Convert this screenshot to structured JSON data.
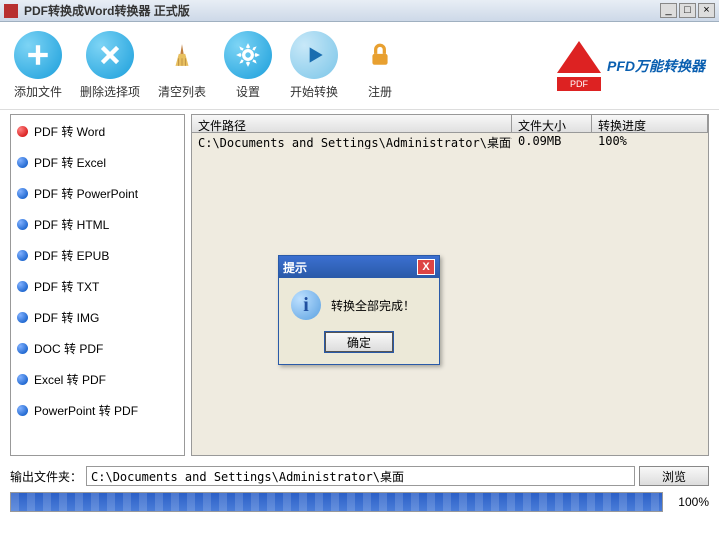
{
  "title": "PDF转换成Word转换器 正式版",
  "winbtns": {
    "min": "_",
    "max": "□",
    "close": "×"
  },
  "toolbar": {
    "add": "添加文件",
    "delete": "删除选择项",
    "clear": "清空列表",
    "settings": "设置",
    "start": "开始转换",
    "register": "注册"
  },
  "pdfbadge": "PDF",
  "brand": "PFD万能转换器",
  "sidebar": [
    {
      "label": "PDF 转 Word",
      "color": "red"
    },
    {
      "label": "PDF 转 Excel",
      "color": "blue"
    },
    {
      "label": "PDF 转 PowerPoint",
      "color": "blue"
    },
    {
      "label": "PDF 转 HTML",
      "color": "blue"
    },
    {
      "label": "PDF 转 EPUB",
      "color": "blue"
    },
    {
      "label": "PDF 转 TXT",
      "color": "blue"
    },
    {
      "label": "PDF 转 IMG",
      "color": "blue"
    },
    {
      "label": "DOC 转 PDF",
      "color": "blue"
    },
    {
      "label": "Excel 转 PDF",
      "color": "blue"
    },
    {
      "label": "PowerPoint 转 PDF",
      "color": "blue"
    }
  ],
  "list": {
    "headers": {
      "path": "文件路径",
      "size": "文件大小",
      "progress": "转换进度"
    },
    "rows": [
      {
        "path": "C:\\Documents and Settings\\Administrator\\桌面\\安卓...",
        "size": "0.09MB",
        "progress": "100%"
      }
    ]
  },
  "dialog": {
    "title": "提示",
    "message": "转换全部完成！",
    "ok": "确定",
    "close": "X"
  },
  "output": {
    "label": "输出文件夹：",
    "path": "C:\\Documents and Settings\\Administrator\\桌面",
    "browse": "浏览"
  },
  "progress": {
    "percent": "100%"
  }
}
